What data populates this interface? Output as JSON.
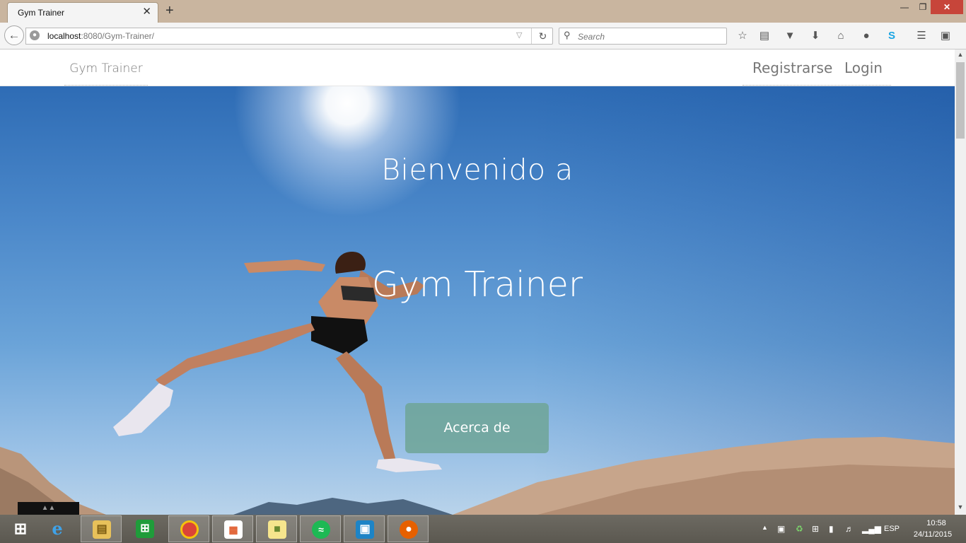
{
  "browser": {
    "tab_title": "Gym Trainer",
    "tab_close": "✕",
    "new_tab": "+",
    "window_min": "—",
    "window_max": "❐",
    "window_close": "✕",
    "url_host": "localhost",
    "url_rest": ":8080/Gym-Trainer/",
    "search_placeholder": "Search",
    "toolbar_icons": [
      "bookmark-star-icon",
      "reading-list-icon",
      "pocket-icon",
      "download-icon",
      "home-icon",
      "chat-icon",
      "skype-icon",
      "menu-icon",
      "extension-icon"
    ]
  },
  "site": {
    "brand": "Gym Trainer",
    "nav": {
      "register": "Registrarse",
      "login": "Login"
    },
    "hero": {
      "title_line1": "Bienvenido a",
      "title_line2": "Gym Trainer",
      "button_label": "Acerca de"
    }
  },
  "taskbar": {
    "apps": [
      "start-button",
      "internet-explorer",
      "file-explorer",
      "windows-store",
      "chrome",
      "apps",
      "sticky-notes",
      "spotify",
      "ide",
      "firefox"
    ],
    "language": "ESP",
    "time": "10:58",
    "date": "24/11/2015"
  },
  "colors": {
    "titlebar": "#c9b59f",
    "sky_top": "#2e6cb5",
    "sky_bottom": "#b9d3ea",
    "button_fill": "#6ea596",
    "close_red": "#c7453a"
  }
}
